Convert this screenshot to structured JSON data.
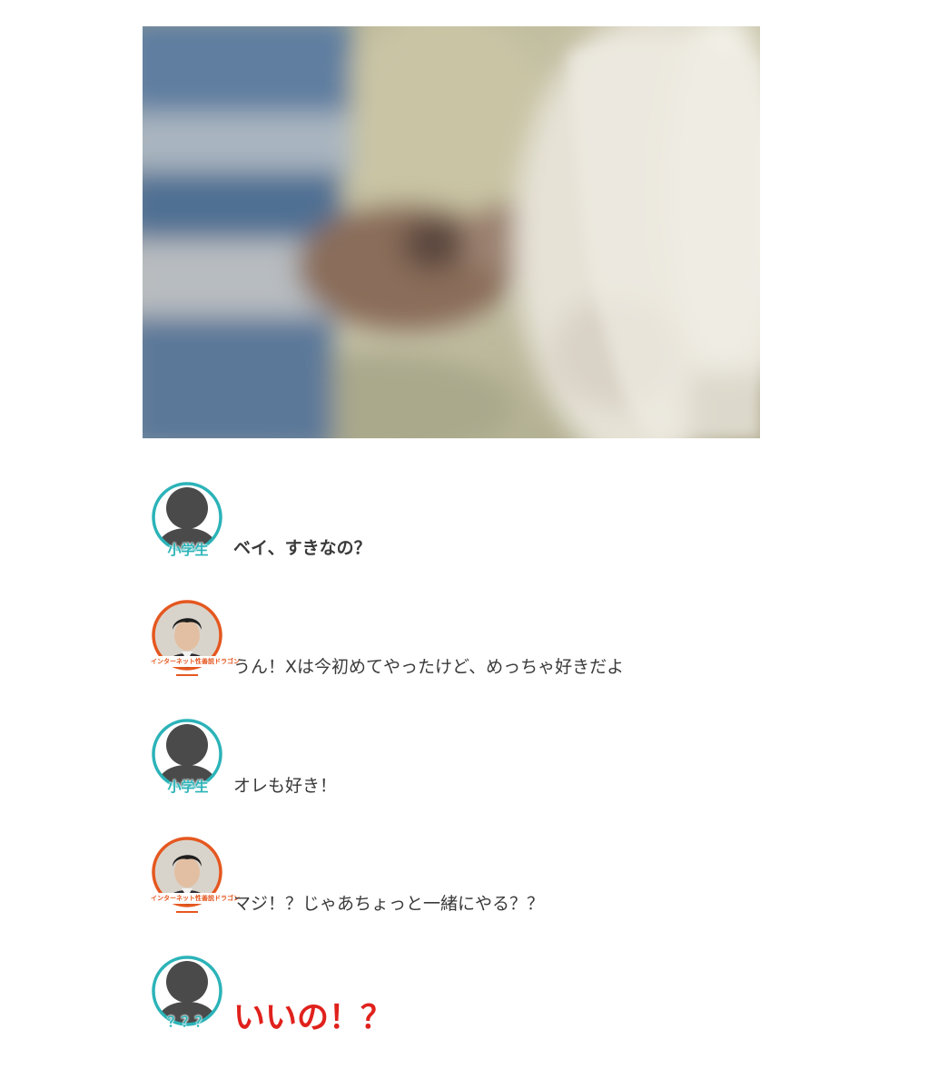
{
  "hero_image": {
    "description_icon": "blurred-photo-image"
  },
  "colors": {
    "teal": "#2bb3b8",
    "orange": "#e5571f",
    "red": "#e0211c",
    "text": "#3a3a3a"
  },
  "conversation": [
    {
      "speaker_tag": "小学生",
      "avatar": "silhouette-avatar",
      "text": "ベイ、すきなの？",
      "style": "bold"
    },
    {
      "speaker_tag": "インターネット性善説ドラゴン",
      "avatar": "photo-avatar",
      "text": "うん！Xは今初めてやったけど、めっちゃ好きだよ",
      "style": "normal"
    },
    {
      "speaker_tag": "小学生",
      "avatar": "silhouette-avatar",
      "text": "オレも好き！",
      "style": "normal"
    },
    {
      "speaker_tag": "インターネット性善説ドラゴン",
      "avatar": "photo-avatar",
      "text": "マジ！？じゃあちょっと一緒にやる？？",
      "style": "normal"
    },
    {
      "speaker_tag": "？？？",
      "avatar": "silhouette-avatar",
      "text": "いいの！？",
      "style": "shout"
    }
  ]
}
